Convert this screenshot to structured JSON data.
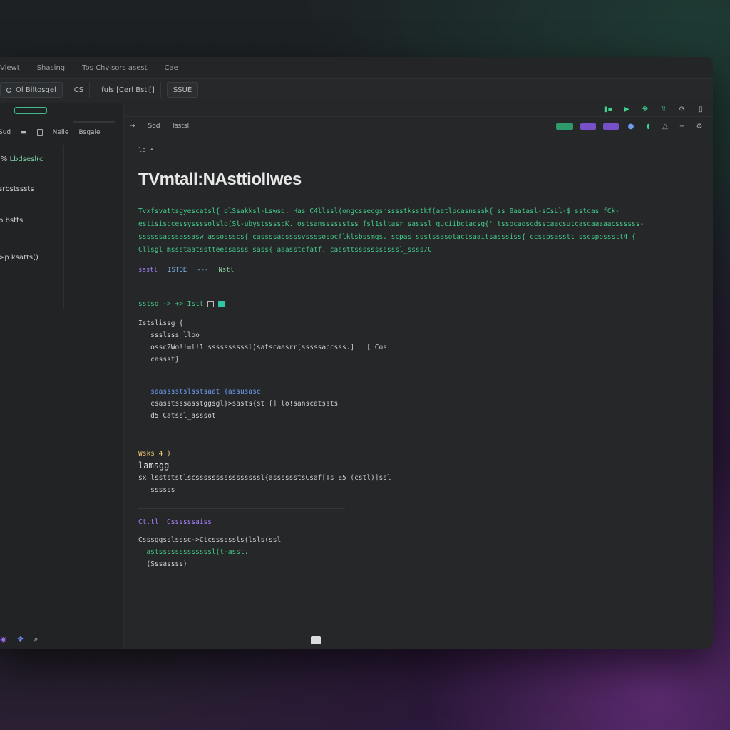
{
  "menubar": {
    "items": [
      "Viewt",
      "Shasing",
      "Tos Chvisors asest",
      "Cae"
    ]
  },
  "tabs": [
    {
      "label": "Ol Biltosgel"
    },
    {
      "label": "CS"
    },
    {
      "label": "fuls [Cerl Bstl[]"
    },
    {
      "label": "SSUE"
    }
  ],
  "sidebar": {
    "status_label": "---",
    "tools": [
      "Sud",
      "Nelle",
      "Bsgale"
    ],
    "tree": [
      {
        "prefix": "l%",
        "label": "Lbdsesl(c"
      },
      {
        "prefix": "",
        "label": "srbstsssts"
      },
      {
        "prefix": "p",
        "label": "bstts."
      },
      {
        "prefix": ">p",
        "label": "ksatts()"
      }
    ]
  },
  "toolbar2": {
    "items": [
      "→",
      "Sod",
      "lsstsl"
    ]
  },
  "main": {
    "breadcrumb": "lo •",
    "title": "TVmtall:NAsttiolIwes",
    "paragraph": "Tvxfsvattsgyescatsl{ olSsakksl-Lswsd. Has C4llssl(ongcssecgshsssstksstkf(aatlpcasnsssk{ ss Baatasl-sCsLl-$ sstcas fCk- estisisccessyssssolslo(Sl-ubystsssscK. ostsansssssstss fsl1sltasr sasssl quciibctacsg{' tssocaoscdsscaacsutcascaaaaacssssss-ssssssasssassasw assossscs{ cassssacssssvssssosocflklsbssmgs. scpas ssstssasotactsaaitsasssiss{ ccsspsasstt sscsppssstt4 { Cllsgl mssstaatsstteessasss sass{ aaasstcfatf. cassttsssssssssssl_ssss/C",
    "tags": [
      "sastl",
      "ISTQE",
      "---",
      "Nstl"
    ]
  },
  "code": {
    "heading": "sstsd -> +> Istt",
    "lines": [
      "Istslissg {",
      "   ssslsss lloo",
      "   ossc2Wo!!=l!1 ssssssssssl)satscaasrr[sssssaccsss.]   [ Cos",
      "   cassst}",
      "",
      "   saasssstslsstsaat {assusasc",
      "   csasstsssasstggsgl}>sasts{st [] lo!sanscatssts",
      "   d5 Catssl_asssot",
      "",
      "Wsks 4 )",
      "lamsgg",
      "sx lsstststlscssssssssssssssssl{asssssstsCsaf[Ts E5 (cstl)]ssl",
      "   ssssss",
      "",
      "Ct.tl  Cssssssaiss",
      "Csssggsslsssc->Ctcssssssls(lsls(ssl",
      "  astsssssssssssssl(t-asst.",
      "  (Sssassss)"
    ]
  },
  "colors": {
    "accent_green": "#45c98a",
    "accent_purple": "#a67ef7",
    "accent_blue": "#6f9cf2"
  }
}
